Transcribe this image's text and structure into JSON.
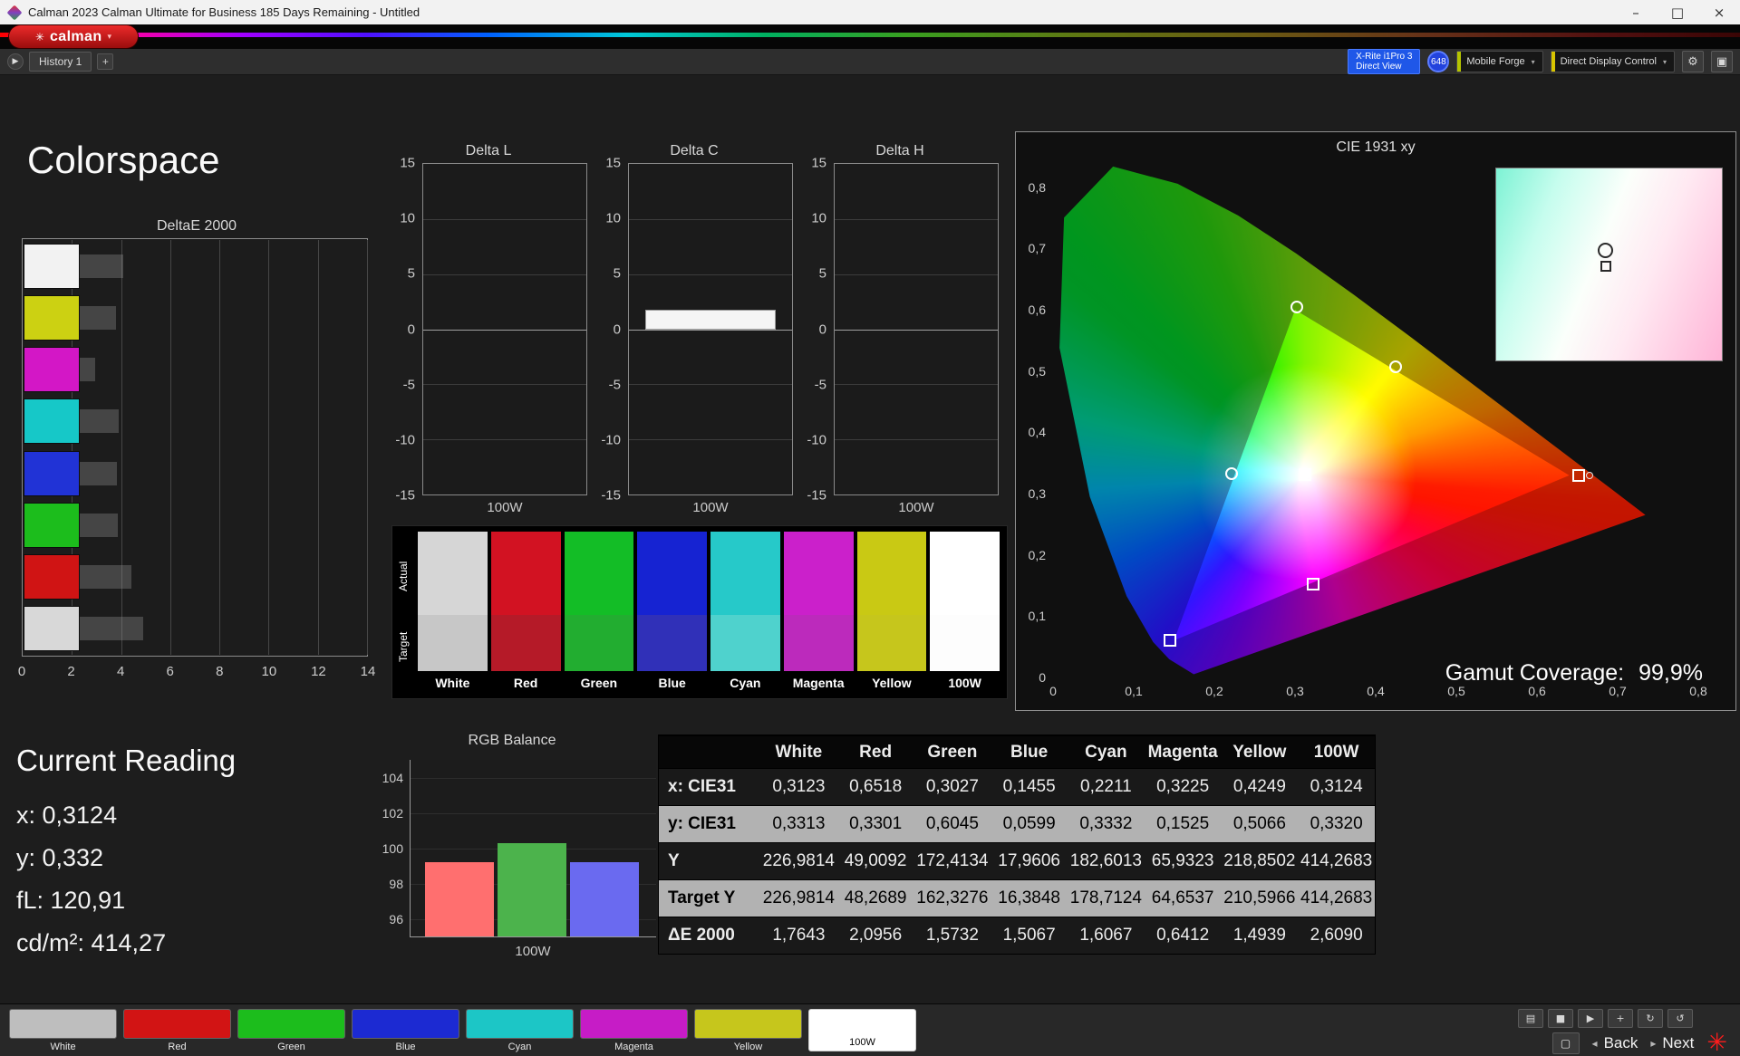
{
  "window": {
    "title": "Calman 2023 Calman Ultimate for Business 185 Days Remaining  - Untitled",
    "controls": [
      {
        "name": "minimize-button",
        "glyph": "–"
      },
      {
        "name": "maximize-button",
        "glyph": "□"
      },
      {
        "name": "close-button",
        "glyph": "×"
      }
    ]
  },
  "brand": {
    "logo_text": "calman",
    "logo_glyph": "✳",
    "caret": "▾"
  },
  "tabbar": {
    "history_expand_glyph": "▶",
    "history_tab": "History 1",
    "add_tab": "+",
    "meter_line1": "X-Rite i1Pro 3",
    "meter_line2": "Direct View",
    "meter_badge": "648",
    "source_button": "Mobile Forge",
    "source_accent": "#b5c400",
    "display_button": "Direct Display Control",
    "display_accent": "#d8c400",
    "gear_glyph": "⚙",
    "display_control_glyph": "▣",
    "caret": "▾"
  },
  "page": {
    "title": "Colorspace"
  },
  "charts": {
    "deltae": {
      "type": "bar",
      "title": "DeltaE 2000",
      "xticks": [
        "0",
        "2",
        "4",
        "6",
        "8",
        "10",
        "12",
        "14"
      ],
      "xmax": 14,
      "rows": [
        {
          "name": "White",
          "value": 1.7643,
          "color": "#f2f2f2"
        },
        {
          "name": "Yellow",
          "value": 1.4939,
          "color": "#ccd112"
        },
        {
          "name": "Magenta",
          "value": 0.6412,
          "color": "#d317c6"
        },
        {
          "name": "Cyan",
          "value": 1.6067,
          "color": "#16c8c8"
        },
        {
          "name": "Blue",
          "value": 1.5067,
          "color": "#2133d6"
        },
        {
          "name": "Green",
          "value": 1.5732,
          "color": "#1cbd1c"
        },
        {
          "name": "Red",
          "value": 2.0956,
          "color": "#d01414"
        },
        {
          "name": "100W",
          "value": 2.609,
          "color": "#d8d8d8"
        }
      ]
    },
    "delta_yticks": [
      "15",
      "10",
      "5",
      "0",
      "-5",
      "-10",
      "-15"
    ],
    "delta_bars": [
      {
        "title": "Delta L",
        "value": 0,
        "xlabel": "100W"
      },
      {
        "title": "Delta C",
        "value": 1.8,
        "xlabel": "100W"
      },
      {
        "title": "Delta H",
        "value": 0,
        "xlabel": "100W"
      }
    ],
    "rgb_balance": {
      "type": "bar",
      "title": "RGB Balance",
      "xlabel": "100W",
      "yticks": [
        "104",
        "102",
        "100",
        "98",
        "96"
      ],
      "ymin": 95,
      "ymax": 105,
      "series": [
        {
          "name": "Red",
          "value": 99.2,
          "color": "#ff6f6f"
        },
        {
          "name": "Green",
          "value": 100.3,
          "color": "#4cb34c"
        },
        {
          "name": "Blue",
          "value": 99.2,
          "color": "#6a6af0"
        }
      ]
    },
    "cie": {
      "type": "scatter",
      "title": "CIE 1931 xy",
      "xticks": [
        "0",
        "0,1",
        "0,2",
        "0,3",
        "0,4",
        "0,5",
        "0,6",
        "0,7",
        "0,8"
      ],
      "yticks": [
        "0,8",
        "0,7",
        "0,6",
        "0,5",
        "0,4",
        "0,3",
        "0,2",
        "0,1",
        "0"
      ],
      "xlim": [
        0,
        0.8
      ],
      "ylim": [
        0,
        0.85
      ],
      "gamut_coverage_label": "Gamut Coverage:",
      "gamut_coverage_value": "99,9%",
      "points": [
        {
          "name": "white",
          "x": 0.3123,
          "y": 0.3313,
          "marker": "square-circle"
        },
        {
          "name": "cyan",
          "x": 0.2211,
          "y": 0.3332,
          "marker": "circle"
        },
        {
          "name": "green",
          "x": 0.3027,
          "y": 0.6045,
          "marker": "circle"
        },
        {
          "name": "yellow",
          "x": 0.4249,
          "y": 0.5066,
          "marker": "circle"
        },
        {
          "name": "magenta",
          "x": 0.3225,
          "y": 0.1525,
          "marker": "square"
        },
        {
          "name": "blue",
          "x": 0.1455,
          "y": 0.0599,
          "marker": "square"
        },
        {
          "name": "red",
          "x": 0.6518,
          "y": 0.3301,
          "marker": "square-dot"
        }
      ]
    }
  },
  "patches": {
    "row_labels": [
      "Actual",
      "Target"
    ],
    "columns": [
      {
        "label": "White",
        "actual": "#d6d6d6",
        "target": "#c7c7c7"
      },
      {
        "label": "Red",
        "actual": "#d21222",
        "target": "#b51a28"
      },
      {
        "label": "Green",
        "actual": "#13bd26",
        "target": "#22ad30"
      },
      {
        "label": "Blue",
        "actual": "#1623d2",
        "target": "#3030b8"
      },
      {
        "label": "Cyan",
        "actual": "#26c9c9",
        "target": "#4fd2cd"
      },
      {
        "label": "Magenta",
        "actual": "#cb20cb",
        "target": "#bc2abc"
      },
      {
        "label": "Yellow",
        "actual": "#c9c914",
        "target": "#c6c61c"
      },
      {
        "label": "100W",
        "actual": "#ffffff",
        "target": "#fdfdfd"
      }
    ]
  },
  "current_reading": {
    "title": "Current Reading",
    "lines": [
      "x: 0,3124",
      "y: 0,332",
      "fL: 120,91",
      "cd/m²: 414,27"
    ]
  },
  "table": {
    "columns": [
      "White",
      "Red",
      "Green",
      "Blue",
      "Cyan",
      "Magenta",
      "Yellow",
      "100W"
    ],
    "rows": [
      {
        "label": "x: CIE31",
        "light": false,
        "values": [
          "0,3123",
          "0,6518",
          "0,3027",
          "0,1455",
          "0,2211",
          "0,3225",
          "0,4249",
          "0,3124"
        ]
      },
      {
        "label": "y: CIE31",
        "light": true,
        "values": [
          "0,3313",
          "0,3301",
          "0,6045",
          "0,0599",
          "0,3332",
          "0,1525",
          "0,5066",
          "0,3320"
        ]
      },
      {
        "label": "Y",
        "light": false,
        "values": [
          "226,9814",
          "49,0092",
          "172,4134",
          "17,9606",
          "182,6013",
          "65,9323",
          "218,8502",
          "414,2683"
        ]
      },
      {
        "label": "Target Y",
        "light": true,
        "values": [
          "226,9814",
          "48,2689",
          "162,3276",
          "16,3848",
          "178,7124",
          "64,6537",
          "210,5966",
          "414,2683"
        ]
      },
      {
        "label": "ΔE 2000",
        "light": false,
        "values": [
          "1,7643",
          "2,0956",
          "1,5732",
          "1,5067",
          "1,6067",
          "0,6412",
          "1,4939",
          "2,6090"
        ]
      }
    ]
  },
  "bottombar": {
    "color_buttons": [
      {
        "label": "White",
        "color": "#bebebe",
        "selected": false
      },
      {
        "label": "Red",
        "color": "#d21414",
        "selected": false
      },
      {
        "label": "Green",
        "color": "#1cbd1c",
        "selected": false
      },
      {
        "label": "Blue",
        "color": "#1c2ad2",
        "selected": false
      },
      {
        "label": "Cyan",
        "color": "#1cc6c6",
        "selected": false
      },
      {
        "label": "Magenta",
        "color": "#c61cc6",
        "selected": false
      },
      {
        "label": "Yellow",
        "color": "#c6c61c",
        "selected": false
      },
      {
        "label": "100W",
        "color": "#ffffff",
        "selected": true
      }
    ],
    "tool_buttons": [
      {
        "name": "display-capture-icon",
        "glyph": "▤"
      },
      {
        "name": "stop-icon",
        "glyph": "■"
      },
      {
        "name": "play-icon",
        "glyph": "▶"
      },
      {
        "name": "pin-icon",
        "glyph": "+"
      },
      {
        "name": "redo-icon",
        "glyph": "↻"
      },
      {
        "name": "undo-icon",
        "glyph": "↺"
      }
    ],
    "aux_button_glyph": "▢",
    "back_icon": "◂",
    "next_icon": "▸",
    "nav": {
      "back": "Back",
      "next": "Next"
    },
    "asterisk_glyph": "✳"
  }
}
